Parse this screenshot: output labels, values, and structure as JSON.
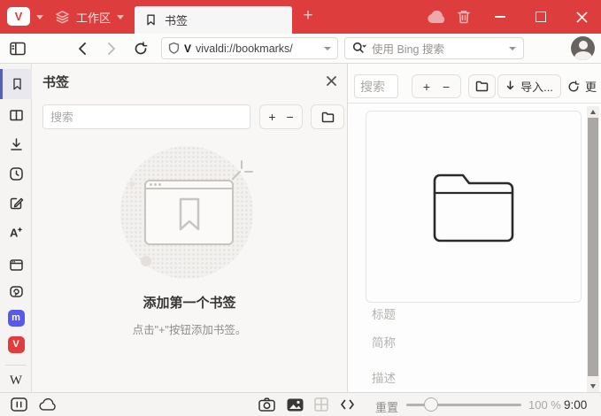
{
  "tabbar": {
    "workspace_label": "工作区",
    "tab_title": "书签",
    "new_tab_label": "+"
  },
  "addressbar": {
    "url": "vivaldi://bookmarks/",
    "scheme_badge": "V",
    "search_placeholder": "使用 Bing 搜索"
  },
  "icons": {
    "vivaldi_logo_letter": "V",
    "mastodon_letter": "m",
    "wikipedia_letter": "W",
    "translate_letter": "A"
  },
  "panel": {
    "title": "书签",
    "search_placeholder": "搜索",
    "add_label": "+",
    "remove_label": "−",
    "empty_heading": "添加第一个书签",
    "empty_hint": "点击\"+\"按钮添加书签。"
  },
  "manager": {
    "search_placeholder": "搜索",
    "add_label": "+",
    "remove_label": "−",
    "import_label": "导入...",
    "more_label": "更",
    "title_placeholder": "标题",
    "nickname_placeholder": "简称",
    "description_placeholder": "描述"
  },
  "statusbar": {
    "reset_label": "重置",
    "zoom_value": "100 %",
    "clock": "9:00"
  },
  "colors": {
    "accent_red": "#dd3d3d",
    "active_item_border": "#5560b5",
    "mastodon_blue": "#5759e8"
  }
}
